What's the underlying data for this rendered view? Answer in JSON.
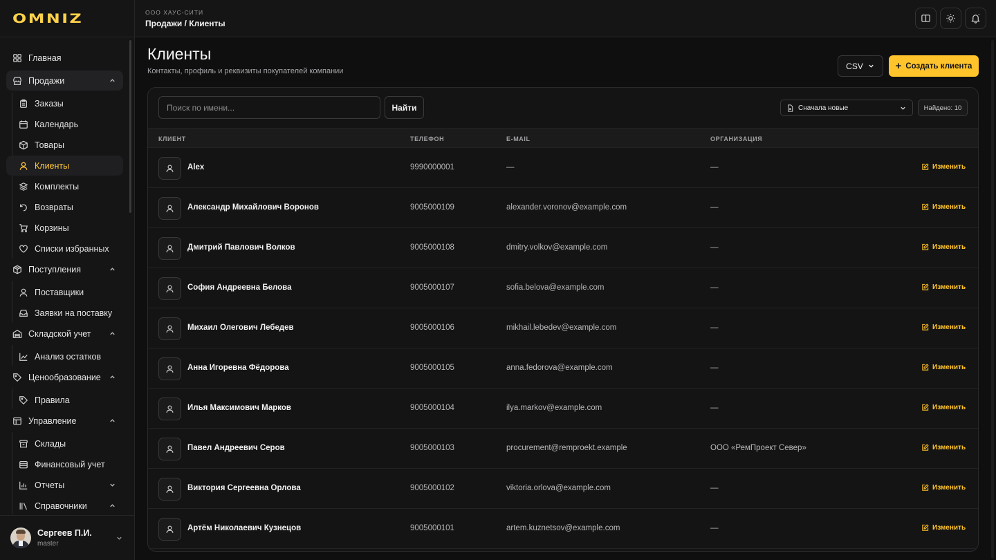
{
  "brand": {
    "logo": "OMNIZ",
    "accent": "#ffc42b"
  },
  "header": {
    "company": "ООО ХАУС-СИТИ",
    "breadcrumb": "Продажи / Клиенты",
    "buttons": [
      "book-icon",
      "sun-icon",
      "bell-icon"
    ]
  },
  "sidebar": {
    "home": "Главная",
    "sales": "Продажи",
    "sales_items": [
      "Заказы",
      "Календарь",
      "Товары",
      "Клиенты",
      "Комплекты",
      "Возвраты",
      "Корзины",
      "Списки избранных"
    ],
    "receipts": "Поступления",
    "receipts_items": [
      "Поставщики",
      "Заявки на поставку"
    ],
    "warehouse": "Складской учет",
    "warehouse_items": [
      "Анализ остатков"
    ],
    "pricing": "Ценообразование",
    "pricing_items": [
      "Правила"
    ],
    "management": "Управление",
    "management_items": [
      "Склады",
      "Финансовый учет",
      "Отчеты",
      "Справочники"
    ],
    "active": "Клиенты"
  },
  "user": {
    "name": "Сергеев П.И.",
    "role": "master"
  },
  "page": {
    "title": "Клиенты",
    "subtitle": "Контакты, профиль и реквизиты покупателей компании",
    "csv_label": "CSV",
    "create_label": "Создать клиента"
  },
  "toolbar": {
    "search_placeholder": "Поиск по имени...",
    "search_value": "",
    "find_label": "Найти",
    "sort_value": "Сначала новые",
    "found_label": "Найдено: 10"
  },
  "table": {
    "columns": [
      "КЛИЕНТ",
      "ТЕЛЕФОН",
      "E-MAIL",
      "ОРГАНИЗАЦИЯ"
    ],
    "edit_label": "Изменить",
    "rows": [
      {
        "name": "Alex",
        "phone": "9990000001",
        "email": "—",
        "org": "—"
      },
      {
        "name": "Александр Михайлович Воронов",
        "phone": "9005000109",
        "email": "alexander.voronov@example.com",
        "org": "—"
      },
      {
        "name": "Дмитрий Павлович Волков",
        "phone": "9005000108",
        "email": "dmitry.volkov@example.com",
        "org": "—"
      },
      {
        "name": "София Андреевна Белова",
        "phone": "9005000107",
        "email": "sofia.belova@example.com",
        "org": "—"
      },
      {
        "name": "Михаил Олегович Лебедев",
        "phone": "9005000106",
        "email": "mikhail.lebedev@example.com",
        "org": "—"
      },
      {
        "name": "Анна Игоревна Фёдорова",
        "phone": "9005000105",
        "email": "anna.fedorova@example.com",
        "org": "—"
      },
      {
        "name": "Илья Максимович Марков",
        "phone": "9005000104",
        "email": "ilya.markov@example.com",
        "org": "—"
      },
      {
        "name": "Павел Андреевич Серов",
        "phone": "9005000103",
        "email": "procurement@remproekt.example",
        "org": "ООО «РемПроект Север»"
      },
      {
        "name": "Виктория Сергеевна Орлова",
        "phone": "9005000102",
        "email": "viktoria.orlova@example.com",
        "org": "—"
      },
      {
        "name": "Артём Николаевич Кузнецов",
        "phone": "9005000101",
        "email": "artem.kuznetsov@example.com",
        "org": "—"
      }
    ]
  }
}
